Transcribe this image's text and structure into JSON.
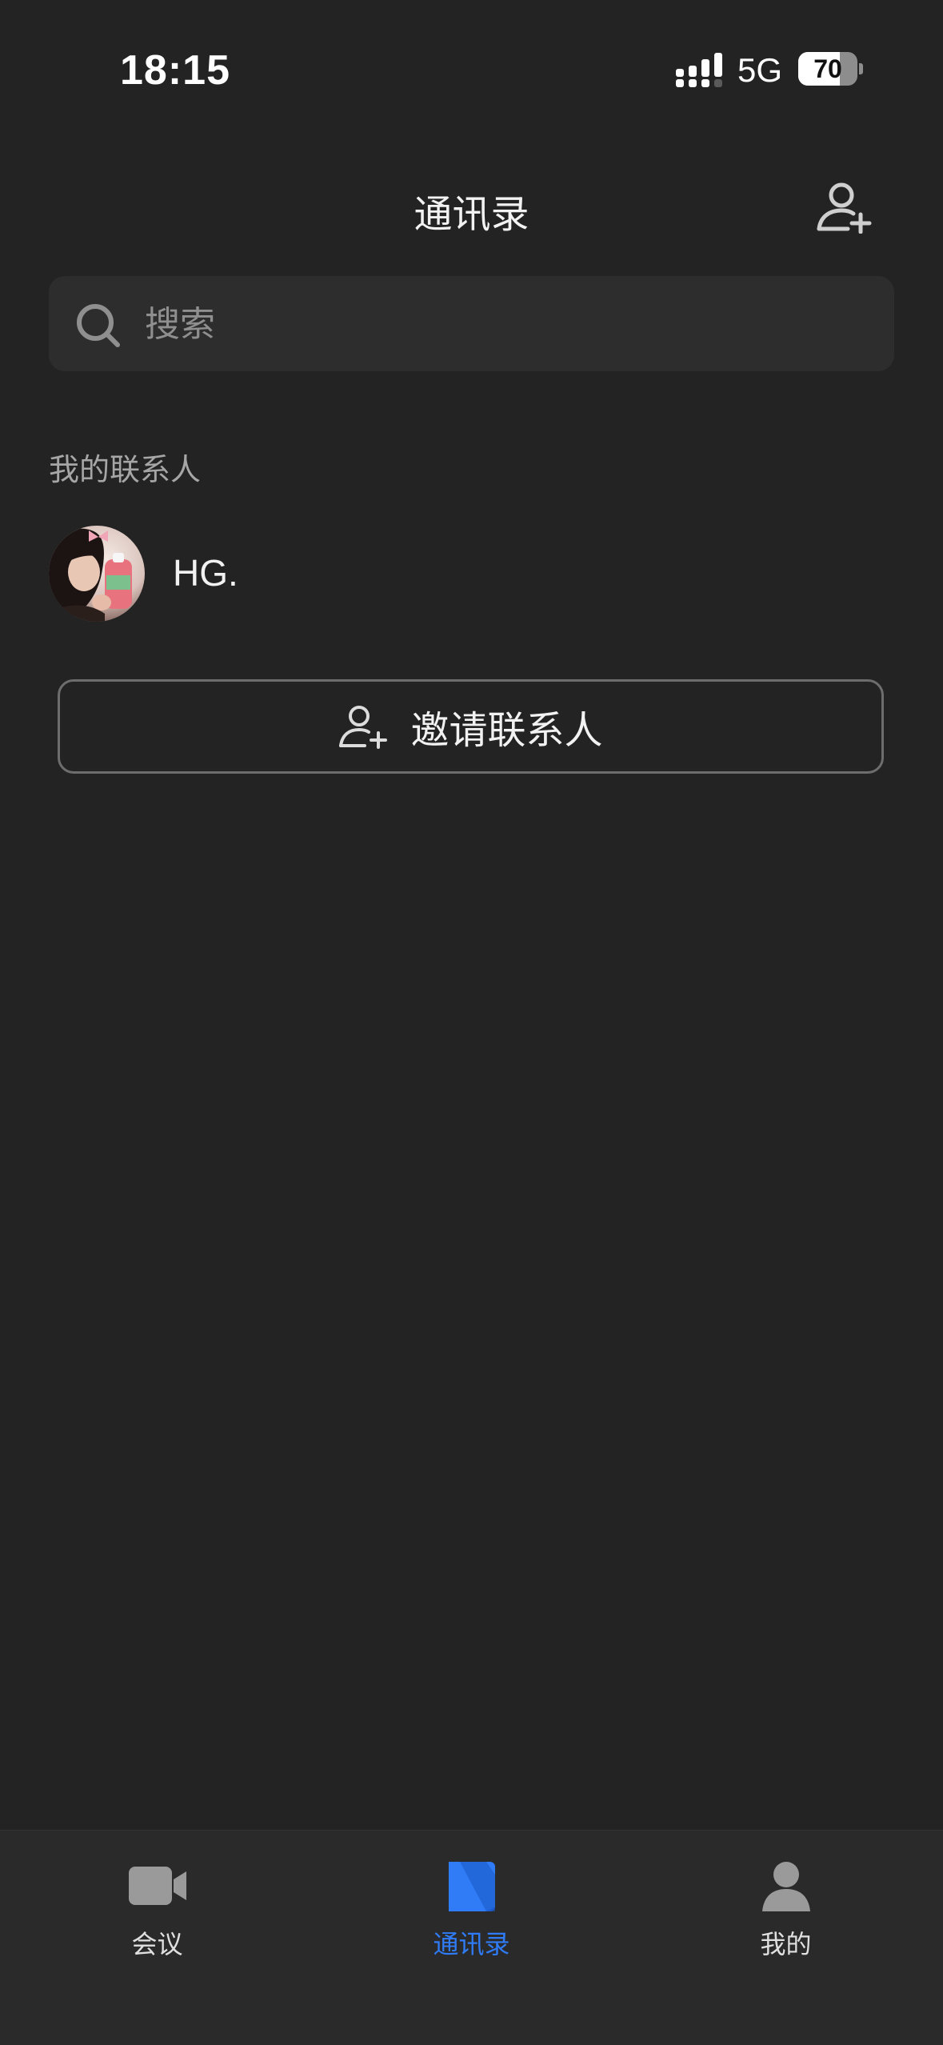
{
  "status_bar": {
    "time": "18:15",
    "network": "5G",
    "battery_percent": "70",
    "battery_level": 0.7
  },
  "header": {
    "title": "通讯录",
    "add_contact_icon": "person-add-icon"
  },
  "search": {
    "placeholder": "搜索",
    "value": "",
    "icon": "search-icon"
  },
  "contacts": {
    "section_title": "我的联系人",
    "items": [
      {
        "name": "HG.",
        "avatar": "avatar-photo"
      }
    ]
  },
  "invite": {
    "label": "邀请联系人",
    "icon": "person-add-icon"
  },
  "tab_bar": {
    "active_color": "#2f7cf6",
    "inactive_color": "#9a9a9a",
    "tabs": [
      {
        "label": "会议",
        "icon": "video-camera-icon",
        "active": false
      },
      {
        "label": "通讯录",
        "icon": "contacts-book-icon",
        "active": true
      },
      {
        "label": "我的",
        "icon": "person-icon",
        "active": false
      }
    ]
  }
}
